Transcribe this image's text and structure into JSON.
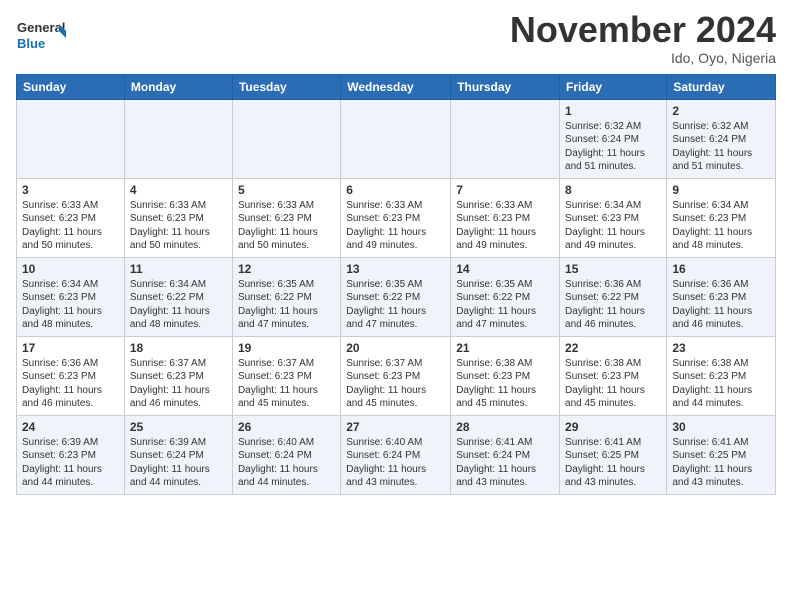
{
  "header": {
    "logo_line1": "General",
    "logo_line2": "Blue",
    "month_title": "November 2024",
    "location": "Ido, Oyo, Nigeria"
  },
  "days_of_week": [
    "Sunday",
    "Monday",
    "Tuesday",
    "Wednesday",
    "Thursday",
    "Friday",
    "Saturday"
  ],
  "weeks": [
    [
      {
        "day": "",
        "info": ""
      },
      {
        "day": "",
        "info": ""
      },
      {
        "day": "",
        "info": ""
      },
      {
        "day": "",
        "info": ""
      },
      {
        "day": "",
        "info": ""
      },
      {
        "day": "1",
        "info": "Sunrise: 6:32 AM\nSunset: 6:24 PM\nDaylight: 11 hours\nand 51 minutes."
      },
      {
        "day": "2",
        "info": "Sunrise: 6:32 AM\nSunset: 6:24 PM\nDaylight: 11 hours\nand 51 minutes."
      }
    ],
    [
      {
        "day": "3",
        "info": "Sunrise: 6:33 AM\nSunset: 6:23 PM\nDaylight: 11 hours\nand 50 minutes."
      },
      {
        "day": "4",
        "info": "Sunrise: 6:33 AM\nSunset: 6:23 PM\nDaylight: 11 hours\nand 50 minutes."
      },
      {
        "day": "5",
        "info": "Sunrise: 6:33 AM\nSunset: 6:23 PM\nDaylight: 11 hours\nand 50 minutes."
      },
      {
        "day": "6",
        "info": "Sunrise: 6:33 AM\nSunset: 6:23 PM\nDaylight: 11 hours\nand 49 minutes."
      },
      {
        "day": "7",
        "info": "Sunrise: 6:33 AM\nSunset: 6:23 PM\nDaylight: 11 hours\nand 49 minutes."
      },
      {
        "day": "8",
        "info": "Sunrise: 6:34 AM\nSunset: 6:23 PM\nDaylight: 11 hours\nand 49 minutes."
      },
      {
        "day": "9",
        "info": "Sunrise: 6:34 AM\nSunset: 6:23 PM\nDaylight: 11 hours\nand 48 minutes."
      }
    ],
    [
      {
        "day": "10",
        "info": "Sunrise: 6:34 AM\nSunset: 6:23 PM\nDaylight: 11 hours\nand 48 minutes."
      },
      {
        "day": "11",
        "info": "Sunrise: 6:34 AM\nSunset: 6:22 PM\nDaylight: 11 hours\nand 48 minutes."
      },
      {
        "day": "12",
        "info": "Sunrise: 6:35 AM\nSunset: 6:22 PM\nDaylight: 11 hours\nand 47 minutes."
      },
      {
        "day": "13",
        "info": "Sunrise: 6:35 AM\nSunset: 6:22 PM\nDaylight: 11 hours\nand 47 minutes."
      },
      {
        "day": "14",
        "info": "Sunrise: 6:35 AM\nSunset: 6:22 PM\nDaylight: 11 hours\nand 47 minutes."
      },
      {
        "day": "15",
        "info": "Sunrise: 6:36 AM\nSunset: 6:22 PM\nDaylight: 11 hours\nand 46 minutes."
      },
      {
        "day": "16",
        "info": "Sunrise: 6:36 AM\nSunset: 6:23 PM\nDaylight: 11 hours\nand 46 minutes."
      }
    ],
    [
      {
        "day": "17",
        "info": "Sunrise: 6:36 AM\nSunset: 6:23 PM\nDaylight: 11 hours\nand 46 minutes."
      },
      {
        "day": "18",
        "info": "Sunrise: 6:37 AM\nSunset: 6:23 PM\nDaylight: 11 hours\nand 46 minutes."
      },
      {
        "day": "19",
        "info": "Sunrise: 6:37 AM\nSunset: 6:23 PM\nDaylight: 11 hours\nand 45 minutes."
      },
      {
        "day": "20",
        "info": "Sunrise: 6:37 AM\nSunset: 6:23 PM\nDaylight: 11 hours\nand 45 minutes."
      },
      {
        "day": "21",
        "info": "Sunrise: 6:38 AM\nSunset: 6:23 PM\nDaylight: 11 hours\nand 45 minutes."
      },
      {
        "day": "22",
        "info": "Sunrise: 6:38 AM\nSunset: 6:23 PM\nDaylight: 11 hours\nand 45 minutes."
      },
      {
        "day": "23",
        "info": "Sunrise: 6:38 AM\nSunset: 6:23 PM\nDaylight: 11 hours\nand 44 minutes."
      }
    ],
    [
      {
        "day": "24",
        "info": "Sunrise: 6:39 AM\nSunset: 6:23 PM\nDaylight: 11 hours\nand 44 minutes."
      },
      {
        "day": "25",
        "info": "Sunrise: 6:39 AM\nSunset: 6:24 PM\nDaylight: 11 hours\nand 44 minutes."
      },
      {
        "day": "26",
        "info": "Sunrise: 6:40 AM\nSunset: 6:24 PM\nDaylight: 11 hours\nand 44 minutes."
      },
      {
        "day": "27",
        "info": "Sunrise: 6:40 AM\nSunset: 6:24 PM\nDaylight: 11 hours\nand 43 minutes."
      },
      {
        "day": "28",
        "info": "Sunrise: 6:41 AM\nSunset: 6:24 PM\nDaylight: 11 hours\nand 43 minutes."
      },
      {
        "day": "29",
        "info": "Sunrise: 6:41 AM\nSunset: 6:25 PM\nDaylight: 11 hours\nand 43 minutes."
      },
      {
        "day": "30",
        "info": "Sunrise: 6:41 AM\nSunset: 6:25 PM\nDaylight: 11 hours\nand 43 minutes."
      }
    ]
  ]
}
